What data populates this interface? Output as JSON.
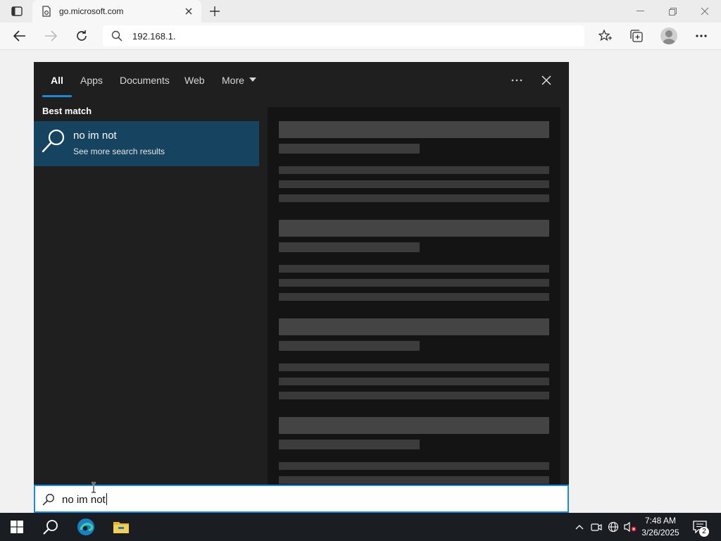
{
  "browser": {
    "tab_title": "go.microsoft.com",
    "address_value": "192.168.1."
  },
  "search_panel": {
    "tabs": [
      {
        "label": "All",
        "active": true
      },
      {
        "label": "Apps"
      },
      {
        "label": "Documents"
      },
      {
        "label": "Web"
      },
      {
        "label": "More"
      }
    ],
    "best_match_label": "Best match",
    "result": {
      "title": "no im not",
      "subtitle": "See more search results"
    },
    "query": "no im not"
  },
  "taskbar": {
    "time": "7:48 AM",
    "date": "3/26/2025",
    "notification_count": "2"
  },
  "colors": {
    "accent": "#1a8ad4",
    "panel_bg": "#1f1f1f",
    "selected_result_bg": "#16435f",
    "taskbar_bg": "#1a1d21"
  },
  "icons": [
    "tab-actions-icon",
    "page-favicon-icon",
    "close-tab-icon",
    "new-tab-icon",
    "minimize-icon",
    "restore-icon",
    "close-window-icon",
    "back-icon",
    "forward-icon",
    "refresh-icon",
    "search-icon",
    "favorites-icon",
    "collections-icon",
    "profile-avatar",
    "more-icon",
    "windows-start-icon",
    "edge-icon",
    "file-explorer-icon",
    "chevron-up-icon",
    "meet-now-icon",
    "network-icon",
    "volume-muted-icon",
    "notification-icon"
  ]
}
